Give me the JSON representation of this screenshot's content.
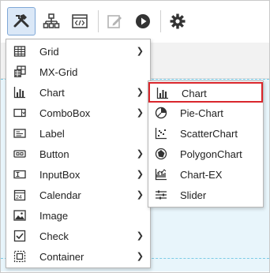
{
  "toolbar": {
    "buttons": [
      {
        "icon": "component-tools-icon",
        "active": true
      },
      {
        "icon": "hierarchy-icon",
        "active": false
      },
      {
        "icon": "code-window-icon",
        "active": false
      },
      {
        "icon": "edit-icon",
        "active": false
      },
      {
        "icon": "play-icon",
        "active": false
      },
      {
        "icon": "gear-icon",
        "active": false
      }
    ]
  },
  "menu": {
    "items": [
      {
        "label": "Grid",
        "icon": "grid-icon",
        "submenu": true
      },
      {
        "label": "MX-Grid",
        "icon": "mx-grid-icon",
        "submenu": false
      },
      {
        "label": "Chart",
        "icon": "bar-chart-icon",
        "submenu": true
      },
      {
        "label": "ComboBox",
        "icon": "combobox-icon",
        "submenu": true
      },
      {
        "label": "Label",
        "icon": "label-icon",
        "submenu": false
      },
      {
        "label": "Button",
        "icon": "button-icon",
        "submenu": true
      },
      {
        "label": "InputBox",
        "icon": "inputbox-icon",
        "submenu": true
      },
      {
        "label": "Calendar",
        "icon": "calendar-icon",
        "submenu": true
      },
      {
        "label": "Image",
        "icon": "image-icon",
        "submenu": false
      },
      {
        "label": "Check",
        "icon": "checkbox-icon",
        "submenu": true
      },
      {
        "label": "Container",
        "icon": "container-icon",
        "submenu": true
      }
    ]
  },
  "submenu": {
    "items": [
      {
        "label": "Chart",
        "icon": "bar-chart-icon",
        "highlighted": true
      },
      {
        "label": "Pie-Chart",
        "icon": "pie-chart-icon",
        "highlighted": false
      },
      {
        "label": "ScatterChart",
        "icon": "scatter-chart-icon",
        "highlighted": false
      },
      {
        "label": "PolygonChart",
        "icon": "polygon-chart-icon",
        "highlighted": false
      },
      {
        "label": "Chart-EX",
        "icon": "chart-ex-icon",
        "highlighted": false
      },
      {
        "label": "Slider",
        "icon": "slider-icon",
        "highlighted": false
      }
    ]
  },
  "colors": {
    "accent": "#7fa8d6",
    "highlight_border": "#d9262c",
    "canvas": "#e8f5fb"
  }
}
